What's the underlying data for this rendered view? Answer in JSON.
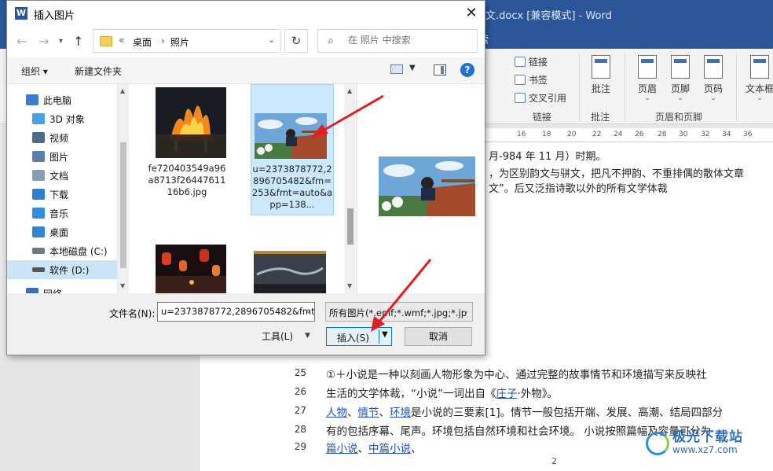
{
  "word": {
    "title": "文.docx [兼容模式] - Word",
    "search_tab": "索",
    "ribbon": {
      "links": "链接",
      "bookmark": "书签",
      "crossref": "交叉引用",
      "link_group": "链接",
      "comment": "批注",
      "comment_group": "批注",
      "header": "页眉",
      "footer": "页脚",
      "page_number": "页码",
      "header_footer_group": "页眉和页脚",
      "textbox": "文本框"
    },
    "ruler": [
      "16",
      "18",
      "20",
      "22",
      "24",
      "26",
      "28",
      "30",
      "32",
      "34",
      "36"
    ],
    "visible_lines": [
      "月-984 年 11 月）时期。",
      "，为区别韵文与骈文，把凡不押韵、不重排偶的散体文章",
      "文”。后又泛指诗歌以外的所有文学体裁"
    ],
    "numbered_lines": [
      {
        "num": "25",
        "text": "①＋小说是一种以刻画人物形象为中心、通过完整的故事情节和环境描写来反映社"
      },
      {
        "num": "26",
        "pre": "生活的文学体裁，“小说”一词出自《",
        "link": "庄子",
        "post": "·外物》。"
      },
      {
        "num": "27",
        "l1": "人物",
        "s1": "、",
        "l2": "情节",
        "s2": "、",
        "l3": "环境",
        "rest": "是小说的三要素[1]。情节一般包括开端、发展、高潮、结局四部分"
      },
      {
        "num": "28",
        "text": "有的包括序幕、尾声。环境包括自然环境和社会环境。 小说按照篇幅及容量可分为"
      },
      {
        "num": "29",
        "l1": "篇小说",
        "s1": "、",
        "l2": "中篇小说",
        "s2": "、"
      }
    ],
    "page_number": "2",
    "watermark": {
      "line1": "极光下载站",
      "line2": "www.xz7.com"
    }
  },
  "dialog": {
    "title": "插入图片",
    "address": {
      "sep": "«",
      "crumb1": "桌面",
      "crumb2": "照片"
    },
    "search_placeholder": "在 照片 中搜索",
    "toolbar": {
      "organize": "组织 ▾",
      "new_folder": "新建文件夹"
    },
    "nav_items": [
      {
        "label": "此电脑",
        "color": "#3a7bd5"
      },
      {
        "label": "3D 对象",
        "color": "#4aa3df"
      },
      {
        "label": "视频",
        "color": "#4d6b8a"
      },
      {
        "label": "图片",
        "color": "#5a7fa8"
      },
      {
        "label": "文档",
        "color": "#8a9bb5"
      },
      {
        "label": "下载",
        "color": "#2f7fd0"
      },
      {
        "label": "音乐",
        "color": "#2f8fdf"
      },
      {
        "label": "桌面",
        "color": "#2f86d6"
      },
      {
        "label": "本地磁盘 (C:)",
        "color": "#6a7a8a"
      },
      {
        "label": "软件 (D:)",
        "color": "#555555"
      },
      {
        "label": "网络",
        "color": "#3a6fb0"
      }
    ],
    "files": [
      {
        "name": "fe720403549a96a8713f2644761116b6.jpg"
      },
      {
        "name": "u=2373878772,2896705482&fm=253&fmt=auto&app=138..."
      },
      {
        "name": ""
      },
      {
        "name": ""
      }
    ],
    "filename_label": "文件名(N):",
    "filename_value": "u=2373878772,2896705482&fmt",
    "filetype_value": "所有图片(*.emf;*.wmf;*.jpg;*.jp",
    "tools_label": "工具(L)",
    "insert_label": "插入(S)",
    "cancel_label": "取消"
  }
}
